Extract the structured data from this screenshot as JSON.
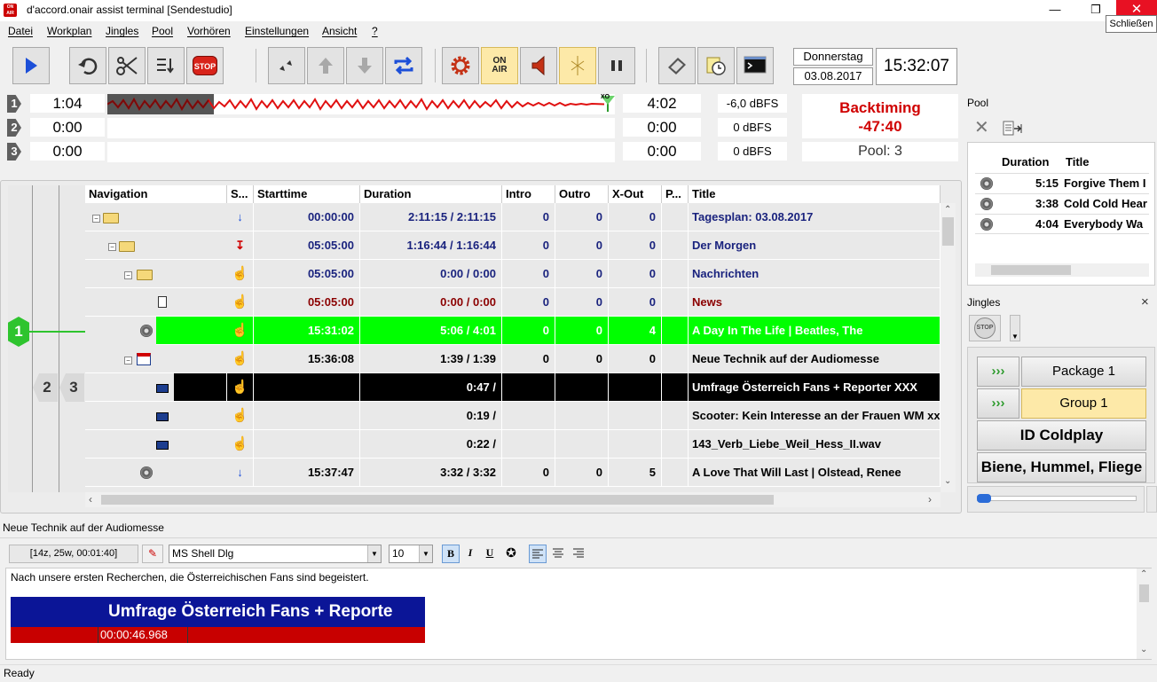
{
  "window": {
    "title": "d'accord.onair assist terminal [Sendestudio]",
    "app_icon": "onair-app-icon",
    "tooltip": "Schließen",
    "minimize": "—",
    "restore": "❐",
    "close": "✕"
  },
  "menu": [
    "Datei",
    "Workplan",
    "Jingles",
    "Pool",
    "Vorhören",
    "Einstellungen",
    "Ansicht",
    "?"
  ],
  "toolbar": {
    "onair": {
      "line1": "ON",
      "line2": "AIR"
    },
    "stop_label": "STOP",
    "day": "Donnerstag",
    "date": "03.08.2017",
    "clock": "15:32:07"
  },
  "players": [
    {
      "index": "1",
      "elapsed": "1:04",
      "remaining": "4:02",
      "level": "-6,0 dBFS",
      "progress": 0.21
    },
    {
      "index": "2",
      "elapsed": "0:00",
      "remaining": "0:00",
      "level": "0 dBFS"
    },
    {
      "index": "3",
      "elapsed": "0:00",
      "remaining": "0:00",
      "level": "0 dBFS"
    }
  ],
  "waveform": {
    "marker": "XO"
  },
  "backtiming": {
    "label": "Backtiming",
    "value": "-47:40",
    "pool": "Pool:  3"
  },
  "playlist": {
    "columns": [
      "Navigation",
      "S...",
      "Starttime",
      "Duration",
      "Intro",
      "Outro",
      "X-Out",
      "P...",
      "Title"
    ],
    "rows": [
      {
        "status": "↓",
        "start": "00:00:00",
        "duration": "2:11:15 / 2:11:15",
        "intro": "0",
        "outro": "0",
        "xout": "0",
        "p": "",
        "title": "Tagesplan: 03.08.2017"
      },
      {
        "status": "↧",
        "start": "05:05:00",
        "duration": "1:16:44 / 1:16:44",
        "intro": "0",
        "outro": "0",
        "xout": "0",
        "p": "",
        "title": "Der Morgen"
      },
      {
        "status": "☝",
        "start": "05:05:00",
        "duration": "0:00 / 0:00",
        "intro": "0",
        "outro": "0",
        "xout": "0",
        "p": "",
        "title": "Nachrichten"
      },
      {
        "status": "☝",
        "start": "05:05:00",
        "duration": "0:00 / 0:00",
        "intro": "0",
        "outro": "0",
        "xout": "0",
        "p": "",
        "title": "News"
      },
      {
        "status": "☝",
        "start": "15:31:02",
        "duration": "5:06 / 4:01",
        "intro": "0",
        "outro": "0",
        "xout": "4",
        "p": "",
        "title": "A Day In The Life | Beatles, The"
      },
      {
        "status": "☝",
        "start": "15:36:08",
        "duration": "1:39 / 1:39",
        "intro": "0",
        "outro": "0",
        "xout": "0",
        "p": "",
        "title": "Neue Technik auf der Audiomesse"
      },
      {
        "status": "☝",
        "start": "",
        "duration": "0:47 /",
        "intro": "",
        "outro": "",
        "xout": "",
        "p": "",
        "title": "Umfrage Österreich Fans + Reporter XXX"
      },
      {
        "status": "☝",
        "start": "",
        "duration": "0:19 /",
        "intro": "",
        "outro": "",
        "xout": "",
        "p": "",
        "title": "Scooter: Kein Interesse an der Frauen WM xx"
      },
      {
        "status": "☝",
        "start": "",
        "duration": "0:22 /",
        "intro": "",
        "outro": "",
        "xout": "",
        "p": "",
        "title": "143_Verb_Liebe_Weil_Hess_II.wav"
      },
      {
        "status": "↓",
        "start": "15:37:47",
        "duration": "3:32 / 3:32",
        "intro": "0",
        "outro": "0",
        "xout": "5",
        "p": "",
        "title": "A Love That Will Last | Olstead, Renee"
      }
    ],
    "player_markers": [
      "1",
      "2",
      "3"
    ]
  },
  "pool": {
    "title": "Pool",
    "columns": [
      "Duration",
      "Title"
    ],
    "rows": [
      {
        "duration": "5:15",
        "title": "Forgive Them I"
      },
      {
        "duration": "3:38",
        "title": "Cold Cold Hear"
      },
      {
        "duration": "4:04",
        "title": "Everybody Wa"
      }
    ]
  },
  "jingles": {
    "title": "Jingles",
    "close": "×",
    "stop": "STOP",
    "arrow": "›››",
    "buttons": [
      "Package 1",
      "Group 1",
      "ID Coldplay",
      "Biene, Hummel, Fliege"
    ]
  },
  "editor": {
    "heading": "Neue Technik auf der Audiomesse",
    "info": "[14z, 25w, 00:01:40]",
    "font": "MS Shell Dlg",
    "size": "10",
    "bold": "B",
    "italic": "I",
    "underline": "U",
    "text": "Nach unsere ersten Recherchen, die Österreichischen Fans sind begeistert.",
    "clip_title": "Umfrage Österreich Fans + Reporte",
    "clip_time": "00:00:46.968"
  },
  "status": "Ready",
  "colors": {
    "accent_green": "#00ff00",
    "backtiming_red": "#d00000",
    "nav_blue": "#1a237e"
  }
}
